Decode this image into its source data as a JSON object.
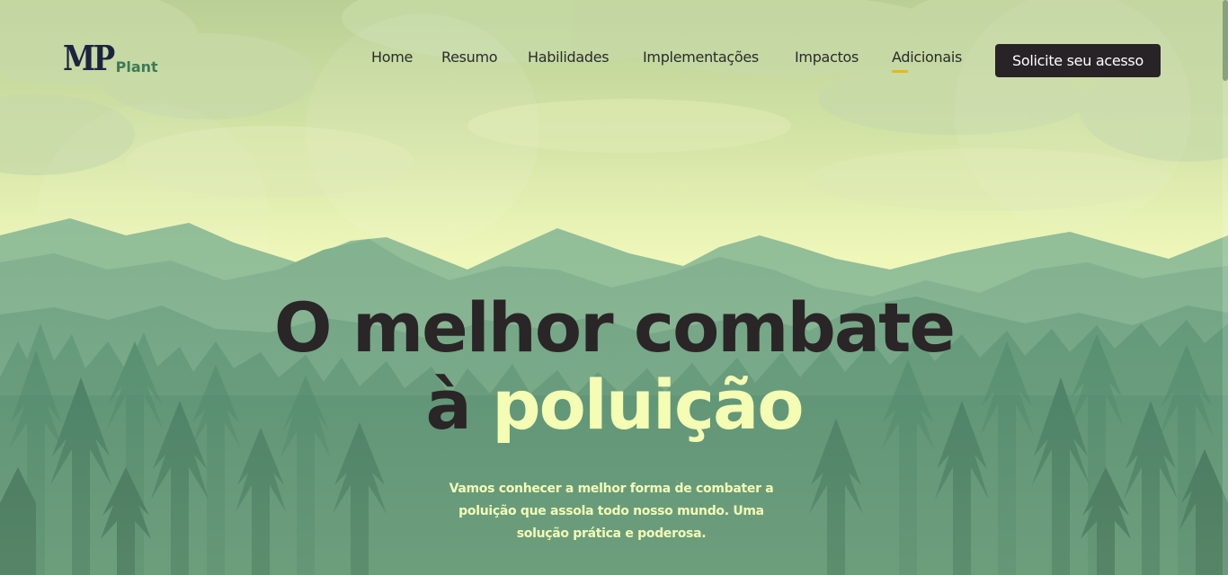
{
  "logo": {
    "mark": "MP",
    "sub": "Plant"
  },
  "nav": {
    "items": [
      {
        "label": "Home"
      },
      {
        "label": "Resumo"
      },
      {
        "label": "Habilidades"
      },
      {
        "label": "Implementações"
      },
      {
        "label": "Impactos"
      },
      {
        "label": "Adicionais",
        "active": true
      }
    ],
    "cta_label": "Solicite seu acesso"
  },
  "hero": {
    "headline_line1": "O melhor combate",
    "headline_prefix": "à ",
    "headline_highlight": "poluição",
    "subtitle": "Vamos conhecer a melhor forma de combater a poluição que assola todo nosso mundo. Uma solução prática e poderosa."
  },
  "colors": {
    "accent": "#e2b91c",
    "highlight": "#f4fdb3",
    "dark": "#2a2527",
    "logo_primary": "#1c2340",
    "logo_secondary": "#3f7a54",
    "sky_top": "#b8cf95",
    "sky_horizon": "#eef7b4",
    "forest_dark": "#1f5a44"
  }
}
